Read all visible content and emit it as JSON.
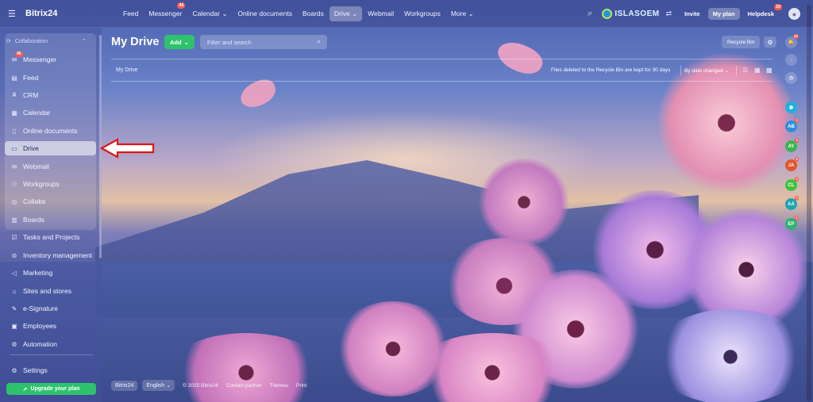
{
  "header": {
    "logo": "Bitrix24",
    "nav": [
      {
        "label": "Feed"
      },
      {
        "label": "Messenger",
        "badge": "46"
      },
      {
        "label": "Calendar"
      },
      {
        "label": "Online documents"
      },
      {
        "label": "Boards"
      },
      {
        "label": "Drive",
        "active": true
      },
      {
        "label": "Webmail"
      },
      {
        "label": "Workgroups"
      },
      {
        "label": "More"
      }
    ],
    "brand": "ISLASOEM",
    "invite": "Invite",
    "my_plan": "My plan",
    "helpdesk": "Helpdesk",
    "helpdesk_badge": "10"
  },
  "sidebar": {
    "group_label": "Collaboration",
    "items": [
      {
        "label": "Messenger",
        "icon": "chat-icon",
        "badge": "46"
      },
      {
        "label": "Feed",
        "icon": "feed-icon"
      },
      {
        "label": "CRM",
        "icon": "crm-icon"
      },
      {
        "label": "Calendar",
        "icon": "calendar-icon"
      },
      {
        "label": "Online documents",
        "icon": "document-icon"
      },
      {
        "label": "Drive",
        "icon": "drive-icon",
        "active": true
      },
      {
        "label": "Webmail",
        "icon": "mail-icon"
      },
      {
        "label": "Workgroups",
        "icon": "group-icon"
      },
      {
        "label": "Collabs",
        "icon": "collab-icon"
      },
      {
        "label": "Boards",
        "icon": "board-icon"
      },
      {
        "label": "Tasks and Projects",
        "icon": "tasks-icon"
      },
      {
        "label": "Inventory management",
        "icon": "inventory-icon"
      },
      {
        "label": "Marketing",
        "icon": "megaphone-icon"
      },
      {
        "label": "Sites and stores",
        "icon": "store-icon"
      },
      {
        "label": "e-Signature",
        "icon": "signature-icon"
      },
      {
        "label": "Employees",
        "icon": "employees-icon"
      },
      {
        "label": "Automation",
        "icon": "automation-icon"
      }
    ],
    "settings": "Settings",
    "upgrade": "Upgrade your plan"
  },
  "main": {
    "title": "My Drive",
    "add_label": "Add",
    "search_placeholder": "Filter and search",
    "recycle_bin": "Recycle Bin",
    "breadcrumb": "My Drive",
    "recycle_note": "Files deleted to the Recycle Bin are kept for 30 days",
    "sort_label": "By date changed"
  },
  "right_rail": {
    "notif_badge": "22",
    "avatars": [
      {
        "initials": "AB",
        "color": "#2f8fd8"
      },
      {
        "initials": "AY",
        "color": "#3fb34f"
      },
      {
        "initials": "JA",
        "color": "#e2552b"
      },
      {
        "initials": "CL",
        "color": "#3fc23f"
      },
      {
        "initials": "AA",
        "color": "#1fa3b0"
      },
      {
        "initials": "EP",
        "color": "#2fb36f"
      }
    ]
  },
  "footer": {
    "brand": "Bitrix24",
    "language": "English",
    "copyright": "© 2025 Bitrix24",
    "links": [
      "Contact partner",
      "Themes",
      "Print"
    ]
  }
}
